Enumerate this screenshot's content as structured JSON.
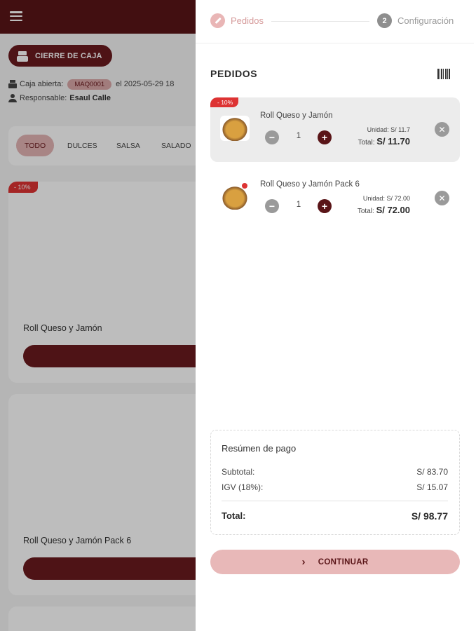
{
  "app": {
    "cierre_label": "CIERRE DE CAJA",
    "caja_abierta_label": "Caja abierta:",
    "caja_code": "MAQ0001",
    "caja_date_text": "el 2025-05-29 18",
    "responsable_label": "Responsable:",
    "responsable_name": "Esaul Calle",
    "filters": [
      "TODO",
      "DULCES",
      "SALSA",
      "SALADO"
    ],
    "active_filter": "TODO",
    "products": [
      {
        "name": "Roll Queso y Jamón",
        "discount": "- 10%"
      },
      {
        "name": "Roll Queso y Jamón Pack 6",
        "discount": ""
      }
    ]
  },
  "drawer": {
    "steps": [
      {
        "number": "",
        "label": "Pedidos",
        "icon": "pencil-icon"
      },
      {
        "number": "2",
        "label": "Configuración"
      }
    ],
    "title": "PEDIDOS",
    "items": [
      {
        "discount": "- 10%",
        "name": "Roll Queso y Jamón",
        "qty": "1",
        "unit_label": "Unidad:",
        "unit_price": "S/ 11.7",
        "total_label": "Total:",
        "total": "S/ 11.70"
      },
      {
        "discount": "",
        "name": "Roll Queso y Jamón Pack 6",
        "qty": "1",
        "unit_label": "Unidad:",
        "unit_price": "S/ 72.00",
        "total_label": "Total:",
        "total": "S/ 72.00"
      }
    ],
    "summary": {
      "title": "Resúmen de pago",
      "subtotal_label": "Subtotal:",
      "subtotal": "S/ 83.70",
      "igv_label": "IGV (18%):",
      "igv": "S/ 15.07",
      "total_label": "Total:",
      "total": "S/ 98.77"
    },
    "continue_label": "CONTINUAR"
  },
  "colors": {
    "brand": "#5a1518",
    "accent_light": "#e8b8b8",
    "discount": "#dd3333"
  }
}
